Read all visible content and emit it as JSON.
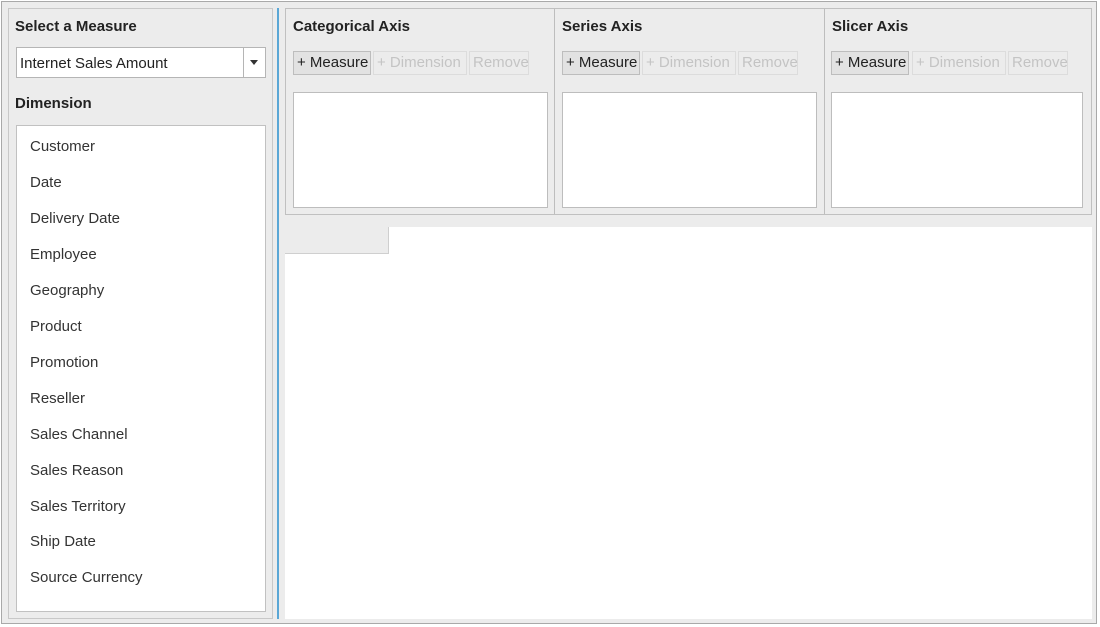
{
  "measure_panel": {
    "title": "Select a Measure",
    "selected_measure": "Internet Sales Amount"
  },
  "dimension_panel": {
    "title": "Dimension",
    "items": [
      "Customer",
      "Date",
      "Delivery Date",
      "Employee",
      "Geography",
      "Product",
      "Promotion",
      "Reseller",
      "Sales Channel",
      "Sales Reason",
      "Sales Territory",
      "Ship Date",
      "Source Currency"
    ]
  },
  "axes": [
    {
      "title": "Categorical Axis",
      "add_measure": "+ Measure",
      "add_dimension": "+ Dimension",
      "remove": "Remove"
    },
    {
      "title": "Series Axis",
      "add_measure": "+ Measure",
      "add_dimension": "+ Dimension",
      "remove": "Remove"
    },
    {
      "title": "Slicer Axis",
      "add_measure": "+ Measure",
      "add_dimension": "+ Dimension",
      "remove": "Remove"
    }
  ],
  "colors": {
    "splitter": "#5aa7d6",
    "panel_bg": "#ececec",
    "disabled_text": "#c4c4c4"
  },
  "icons": {
    "dropdown": "chevron-down-icon"
  }
}
